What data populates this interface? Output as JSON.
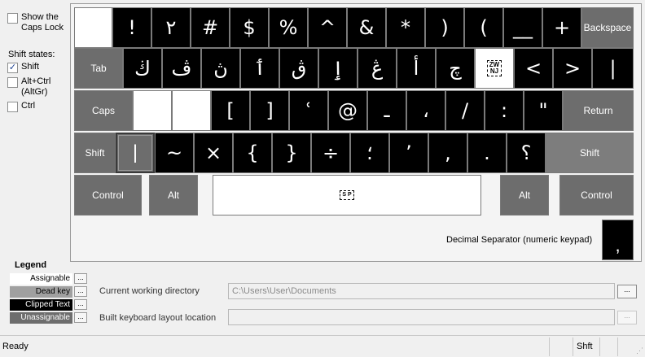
{
  "left_panel": {
    "show_caps_lock_label": "Show the\nCaps Lock",
    "shift_states_label": "Shift states:",
    "shift_label": "Shift",
    "altgr_label": "Alt+Ctrl\n(AltGr)",
    "ctrl_label": "Ctrl",
    "checked_mark": "✓"
  },
  "keyboard": {
    "row1": [
      "",
      "!",
      "٢",
      "#",
      "$",
      "%",
      "^",
      "&",
      "*",
      ")",
      "(",
      "__",
      "+"
    ],
    "backspace_label": "Backspace",
    "tab_label": "Tab",
    "row2": [
      "ڬ",
      "ڤ",
      "ڽ",
      "ٲ",
      "ڨ",
      "ٳ",
      "ڠ",
      "أ",
      "چ"
    ],
    "zwnj_label": "ZW\nNJ",
    "row2_tail": [
      "<",
      ">",
      "|"
    ],
    "caps_label": "Caps",
    "row3": [
      "[",
      "]",
      "ʿ",
      "@",
      "ـ",
      "،",
      "/",
      ":",
      "\""
    ],
    "return_label": "Return",
    "shift_label": "Shift",
    "row4_first": "|",
    "row4": [
      "~",
      "×",
      "{",
      "}",
      "÷",
      "؛",
      "’",
      ",",
      ".",
      "؟"
    ],
    "shift_right_label": "Shift",
    "control_label": "Control",
    "alt_label": "Alt",
    "sp_label": "S P",
    "alt_right_label": "Alt",
    "control_right_label": "Control",
    "decimal_separator_label": "Decimal Separator (numeric keypad)",
    "decimal_separator_value": ","
  },
  "legend": {
    "title": "Legend",
    "assignable": "Assignable",
    "dead_key": "Dead key",
    "clipped_text": "Clipped Text",
    "unassignable": "Unassignable",
    "btn": "..."
  },
  "fields": {
    "cwd_label": "Current working directory",
    "cwd_value": "C:\\Users\\User\\Documents",
    "built_label": "Built keyboard layout location",
    "built_value": "",
    "browse": "..."
  },
  "status": {
    "text": "Ready",
    "shift_state": "Shft"
  },
  "colors": {
    "key_black": "#000000",
    "key_gray": "#6d6d6d",
    "key_white": "#ffffff",
    "dead_key": "#a0a0a0",
    "unassignable": "#6d6d6d"
  }
}
